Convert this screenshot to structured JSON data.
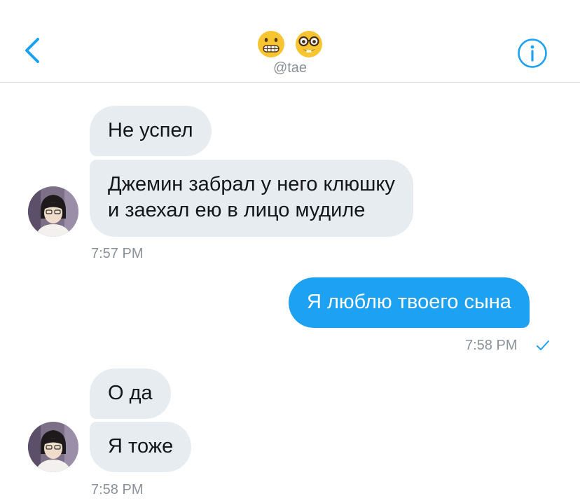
{
  "header": {
    "emojis": [
      "grimacing-face",
      "nerd-face"
    ],
    "handle": "@tae"
  },
  "messages": [
    {
      "text": "Не успел"
    },
    {
      "line1": "Джемин забрал у него клюшку",
      "line2": "и заехал ею в лицо мудиле"
    },
    {
      "text": "Я люблю твоего сына"
    },
    {
      "text": "О да"
    },
    {
      "text": "Я тоже"
    }
  ],
  "timestamps": {
    "t1": "7:57 PM",
    "t2": "7:58 PM",
    "t3": "7:58 PM"
  },
  "colors": {
    "accent": "#1da1f2",
    "incoming_bubble": "#e6ecf0",
    "divider": "#d6d9dd",
    "muted_text": "#8a9198"
  }
}
